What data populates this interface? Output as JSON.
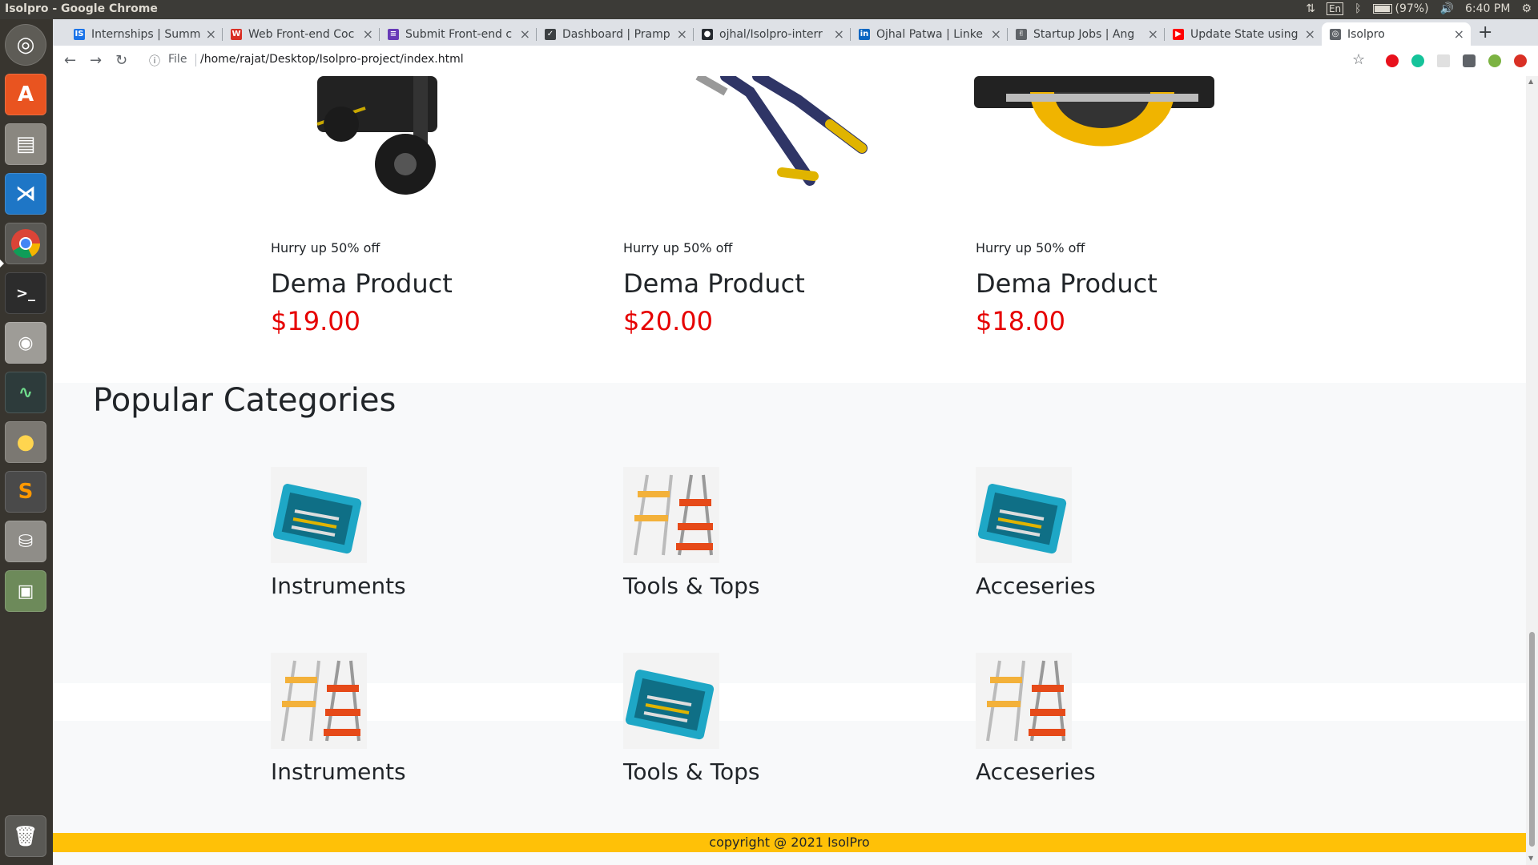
{
  "window": {
    "title": "Isolpro - Google Chrome"
  },
  "top_panel": {
    "lang": "En",
    "battery": "(97%)",
    "time": "6:40 PM"
  },
  "launcher": {
    "items": [
      {
        "name": "ubuntu-dash-icon"
      },
      {
        "name": "software-center-icon"
      },
      {
        "name": "files-icon"
      },
      {
        "name": "vscode-icon"
      },
      {
        "name": "chrome-icon"
      },
      {
        "name": "terminal-icon"
      },
      {
        "name": "camera-icon"
      },
      {
        "name": "system-monitor-icon"
      },
      {
        "name": "lightbulb-icon"
      },
      {
        "name": "sublime-text-icon"
      },
      {
        "name": "disk-icon"
      },
      {
        "name": "image-viewer-icon"
      },
      {
        "name": "trash-icon"
      }
    ]
  },
  "tabs": [
    {
      "title": "Internships | Summ",
      "fav": "IS",
      "color": "#1a73e8"
    },
    {
      "title": "Web Front-end Coc",
      "fav": "W",
      "color": "#d93025"
    },
    {
      "title": "Submit Front-end c",
      "fav": "≡",
      "color": "#673ab7"
    },
    {
      "title": "Dashboard | Pramp",
      "fav": "✓",
      "color": "#3c4043"
    },
    {
      "title": "ojhal/Isolpro-interr",
      "fav": "●",
      "color": "#24292e"
    },
    {
      "title": "Ojhal Patwa | Linke",
      "fav": "in",
      "color": "#0a66c2"
    },
    {
      "title": "Startup Jobs | Ang",
      "fav": "✌",
      "color": "#5f6368"
    },
    {
      "title": "Update State using",
      "fav": "▶",
      "color": "#ff0000"
    },
    {
      "title": "Isolpro",
      "fav": "◎",
      "color": "#5f6368"
    }
  ],
  "address_bar": {
    "scheme_label": "File",
    "url": "/home/rajat/Desktop/Isolpro-project/index.html"
  },
  "products": [
    {
      "hurry": "Hurry up 50% off",
      "name": "Dema Product",
      "price": "$19.00"
    },
    {
      "hurry": "Hurry up 50% off",
      "name": "Dema Product",
      "price": "$20.00"
    },
    {
      "hurry": "Hurry up 50% off",
      "name": "Dema Product",
      "price": "$18.00"
    }
  ],
  "categories_title": "Popular Categories",
  "categories_row1": [
    {
      "label": "Instruments",
      "image": "toolkit"
    },
    {
      "label": "Tools & Tops",
      "image": "ladder"
    },
    {
      "label": "Acceseries",
      "image": "toolkit"
    }
  ],
  "categories_row2": [
    {
      "label": "Instruments",
      "image": "ladder"
    },
    {
      "label": "Tools & Tops",
      "image": "toolkit"
    },
    {
      "label": "Acceseries",
      "image": "ladder"
    }
  ],
  "footer": {
    "text": "copyright @ 2021 IsolPro"
  },
  "colors": {
    "price": "#e60000",
    "footer_bg": "#ffc107",
    "category_band": "#f8f9fa"
  }
}
